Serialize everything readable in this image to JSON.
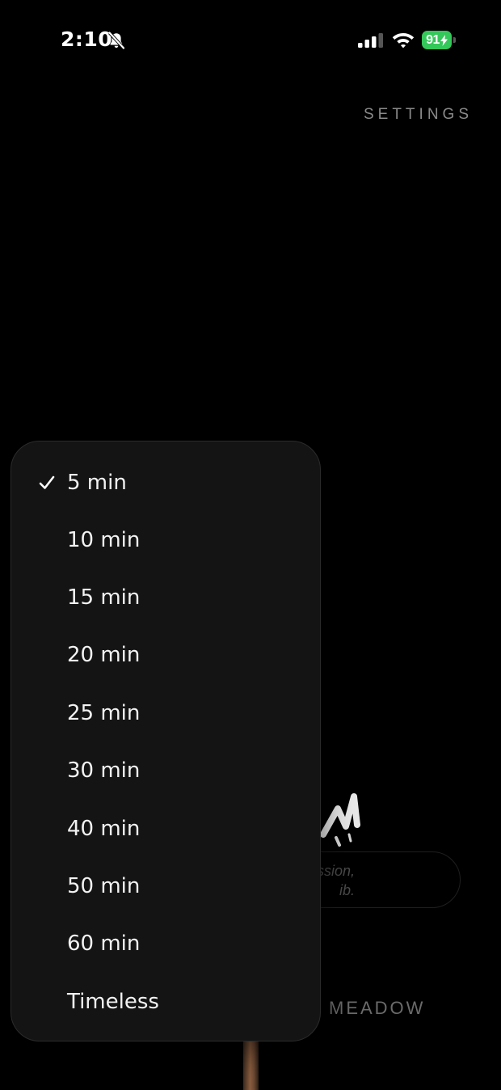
{
  "status_bar": {
    "time": "2:10",
    "battery": "91",
    "battery_color": "#34c759"
  },
  "header": {
    "settings_label": "SETTINGS"
  },
  "background": {
    "subtitle_line1": "ssion,",
    "subtitle_line2": "ib.",
    "meadow_label": "MEADOW"
  },
  "duration_menu": {
    "selected": "5 min",
    "items": [
      {
        "label": "5 min",
        "checked": true
      },
      {
        "label": "10 min",
        "checked": false
      },
      {
        "label": "15 min",
        "checked": false
      },
      {
        "label": "20 min",
        "checked": false
      },
      {
        "label": "25 min",
        "checked": false
      },
      {
        "label": "30 min",
        "checked": false
      },
      {
        "label": "40 min",
        "checked": false
      },
      {
        "label": "50 min",
        "checked": false
      },
      {
        "label": "60 min",
        "checked": false
      },
      {
        "label": "Timeless",
        "checked": false
      }
    ]
  },
  "icons": {
    "silent": "bell-slash-icon",
    "signal": "cellular-signal-icon",
    "wifi": "wifi-icon",
    "battery": "battery-charging-icon",
    "check": "checkmark-icon"
  }
}
